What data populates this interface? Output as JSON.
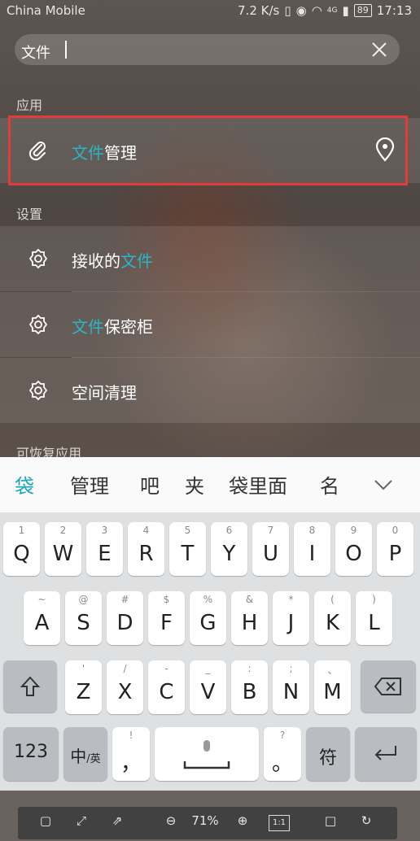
{
  "status_bar": {
    "carrier": "China Mobile",
    "speed": "7.2 K/s",
    "network": "4G",
    "battery": "89",
    "time": "17:13"
  },
  "search": {
    "query": "文件",
    "clear_icon": "close-icon"
  },
  "sections": {
    "apps": "应用",
    "settings": "设置",
    "recoverable": "可恢复应用"
  },
  "app_results": [
    {
      "icon": "paperclip-icon",
      "label_hl": "文件",
      "label_rest": "管理",
      "action_icon": "location-pin-icon"
    }
  ],
  "settings_results": [
    {
      "icon": "gear-icon",
      "label_pre": "接收的",
      "label_hl": "文件",
      "label_post": ""
    },
    {
      "icon": "gear-icon",
      "label_pre": "",
      "label_hl": "文件",
      "label_post": "保密柜"
    },
    {
      "icon": "gear-icon",
      "label_pre": "空间清理",
      "label_hl": "",
      "label_post": ""
    }
  ],
  "candidates": [
    "袋",
    "管理",
    "吧",
    "夹",
    "袋里面",
    "名"
  ],
  "keyboard": {
    "row1": [
      {
        "hint": "1",
        "key": "Q"
      },
      {
        "hint": "2",
        "key": "W"
      },
      {
        "hint": "3",
        "key": "E"
      },
      {
        "hint": "4",
        "key": "R"
      },
      {
        "hint": "5",
        "key": "T"
      },
      {
        "hint": "6",
        "key": "Y"
      },
      {
        "hint": "7",
        "key": "U"
      },
      {
        "hint": "8",
        "key": "I"
      },
      {
        "hint": "9",
        "key": "O"
      },
      {
        "hint": "0",
        "key": "P"
      }
    ],
    "row2": [
      {
        "hint": "~",
        "key": "A"
      },
      {
        "hint": "@",
        "key": "S"
      },
      {
        "hint": "#",
        "key": "D"
      },
      {
        "hint": "$",
        "key": "F"
      },
      {
        "hint": "%",
        "key": "G"
      },
      {
        "hint": "&",
        "key": "H"
      },
      {
        "hint": "*",
        "key": "J"
      },
      {
        "hint": "(",
        "key": "K"
      },
      {
        "hint": ")",
        "key": "L"
      }
    ],
    "row3": [
      {
        "hint": "'",
        "key": "Z"
      },
      {
        "hint": "/",
        "key": "X"
      },
      {
        "hint": "-",
        "key": "C"
      },
      {
        "hint": "_",
        "key": "V"
      },
      {
        "hint": ":",
        "key": "B"
      },
      {
        "hint": ";",
        "key": "N"
      },
      {
        "hint": "、",
        "key": "M"
      }
    ],
    "numbers_key": "123",
    "lang_key": "中",
    "lang_key_alt": "/英",
    "comma_hint": "!",
    "comma_key": "，",
    "period_hint": "?",
    "period_key": "。",
    "symbol_key": "符"
  },
  "toolbar": {
    "zoom": "71%",
    "ratio": "1:1"
  },
  "colors": {
    "highlight": "#29b6c8",
    "selection_box": "#e33b3b"
  }
}
